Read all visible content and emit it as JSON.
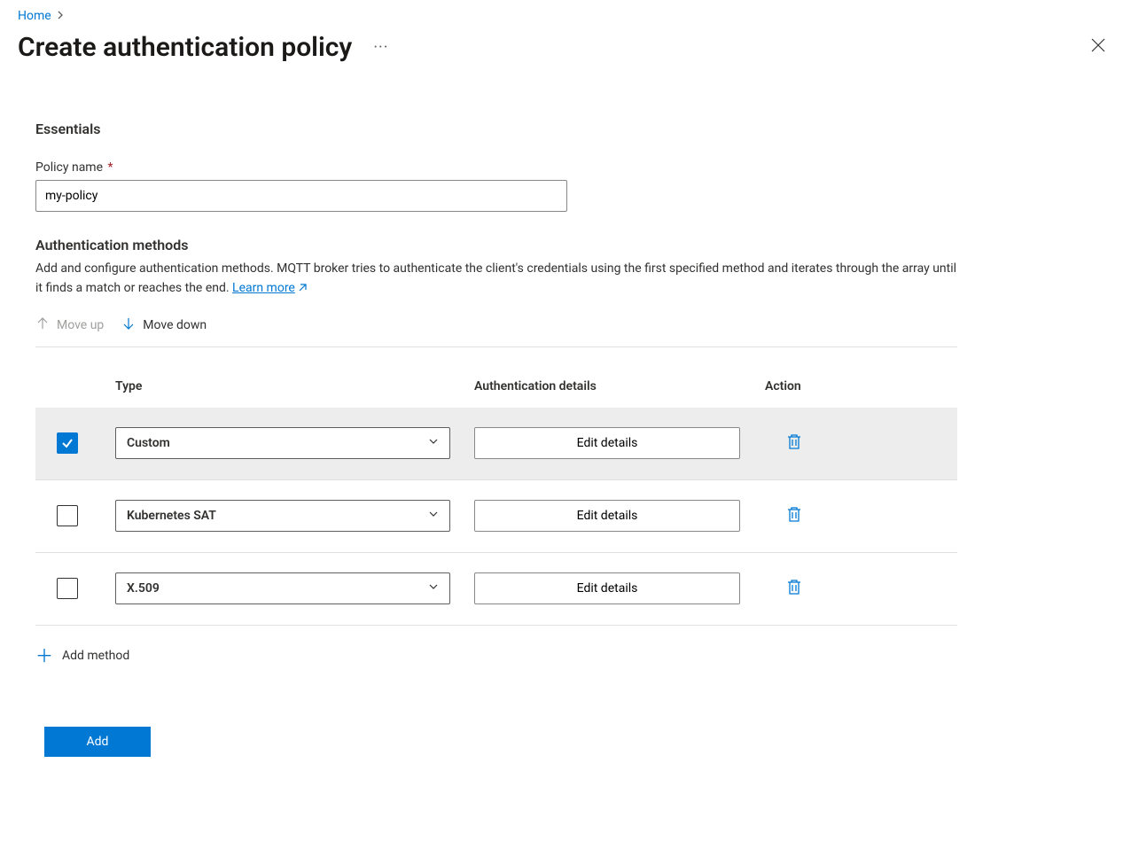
{
  "breadcrumb": {
    "home": "Home"
  },
  "page_title": "Create authentication policy",
  "sections": {
    "essentials": "Essentials",
    "auth_methods": "Authentication methods"
  },
  "policy_name": {
    "label": "Policy name",
    "required_marker": "*",
    "value": "my-policy"
  },
  "auth_description": "Add and configure authentication methods. MQTT broker tries to authenticate the client's credentials using the first specified method and iterates through the array until it finds a match or reaches the end. ",
  "learn_more": "Learn more",
  "toolbar": {
    "move_up": "Move up",
    "move_down": "Move down"
  },
  "table": {
    "headers": {
      "type": "Type",
      "auth_details": "Authentication details",
      "action": "Action"
    },
    "edit_details_label": "Edit details",
    "rows": [
      {
        "selected": true,
        "type": "Custom"
      },
      {
        "selected": false,
        "type": "Kubernetes SAT"
      },
      {
        "selected": false,
        "type": "X.509"
      }
    ]
  },
  "add_method_label": "Add method",
  "footer": {
    "add": "Add"
  }
}
